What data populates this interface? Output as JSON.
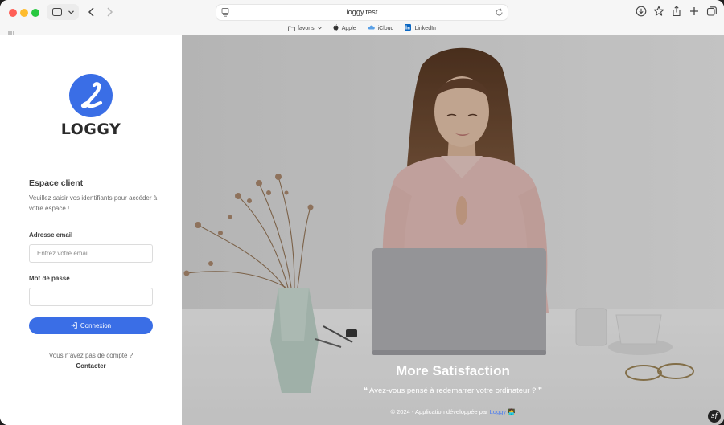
{
  "browser": {
    "url": "loggy.test",
    "bookmarks": [
      {
        "label": "favoris",
        "icon": "folder-icon"
      },
      {
        "label": "Apple",
        "icon": "apple-icon"
      },
      {
        "label": "iCloud",
        "icon": "cloud-icon"
      },
      {
        "label": "LinkedIn",
        "icon": "linkedin-icon"
      }
    ]
  },
  "login": {
    "brand": "LOGGY",
    "title": "Espace client",
    "subtitle": "Veuillez saisir vos identifiants pour accéder à votre espace !",
    "email_label": "Adresse email",
    "email_placeholder": "Entrez votre email",
    "email_value": "",
    "password_label": "Mot de passe",
    "password_value": "",
    "submit_label": "Connexion",
    "no_account_text": "Vous n'avez pas de compte ?",
    "contact_label": "Contacter"
  },
  "hero": {
    "title": "More Satisfaction",
    "quote": "Avez-vous pensé à redemarrer votre ordinateur ?",
    "footer_prefix": "© 2024 - Application développée par",
    "footer_brand": "Loggy",
    "footer_emoji": "🧑‍💻"
  },
  "colors": {
    "accent": "#3a6ee6",
    "link": "#4a7cf0"
  }
}
